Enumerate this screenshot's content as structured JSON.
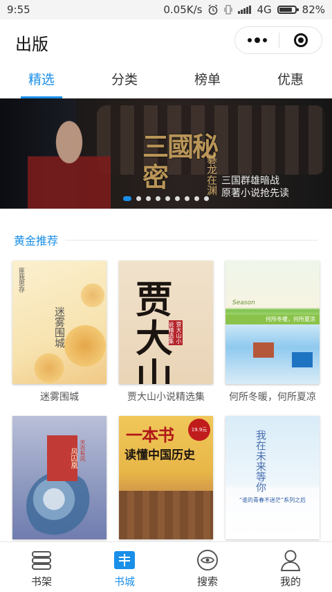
{
  "status_bar": {
    "time": "9:55",
    "network_speed": "0.05K/s",
    "network_type": "4G",
    "battery": "82%",
    "battery_level": 0.82
  },
  "header": {
    "title": "出版",
    "more_icon": "more-dots-icon",
    "close_icon": "close-target-icon"
  },
  "tabs": [
    {
      "label": "精选",
      "active": true
    },
    {
      "label": "分类",
      "active": false
    },
    {
      "label": "榜单",
      "active": false
    },
    {
      "label": "优惠",
      "active": false
    }
  ],
  "banner": {
    "title": "三國秘密",
    "subtitle": "碁龙在渊",
    "line1": "三国群雄暗战",
    "line2": "原著小说抢先读",
    "slide_count": 9,
    "active_slide": 0
  },
  "section": {
    "title": "黄金推荐"
  },
  "books": [
    {
      "title": "迷雾围城",
      "cover_text": "迷雾围城",
      "cover_author": "匪我思存"
    },
    {
      "title": "贾大山小说精选集",
      "cover_text": "贾大山",
      "cover_sub": "贾大山小说精选集"
    },
    {
      "title": "何所冬暖，何所夏凉",
      "cover_text": "何所冬暖，何所夏凉",
      "cover_season": "Season"
    },
    {
      "title": "",
      "cover_text": "风囚凰",
      "cover_sub": "天衣有风"
    },
    {
      "title": "",
      "cover_text": "一本书",
      "cover_sub": "读懂中国历史",
      "cover_badge": "19.9元"
    },
    {
      "title": "",
      "cover_text": "我在未来等你",
      "cover_sub": "“谁的青春不迷茫”系列之后"
    }
  ],
  "bottom_nav": [
    {
      "label": "书架",
      "icon": "bookshelf-icon",
      "active": false
    },
    {
      "label": "书城",
      "icon": "bookstore-icon",
      "active": true
    },
    {
      "label": "搜索",
      "icon": "search-eye-icon",
      "active": false
    },
    {
      "label": "我的",
      "icon": "profile-icon",
      "active": false
    }
  ],
  "colors": {
    "accent": "#1a8fe8",
    "text": "#333333"
  }
}
